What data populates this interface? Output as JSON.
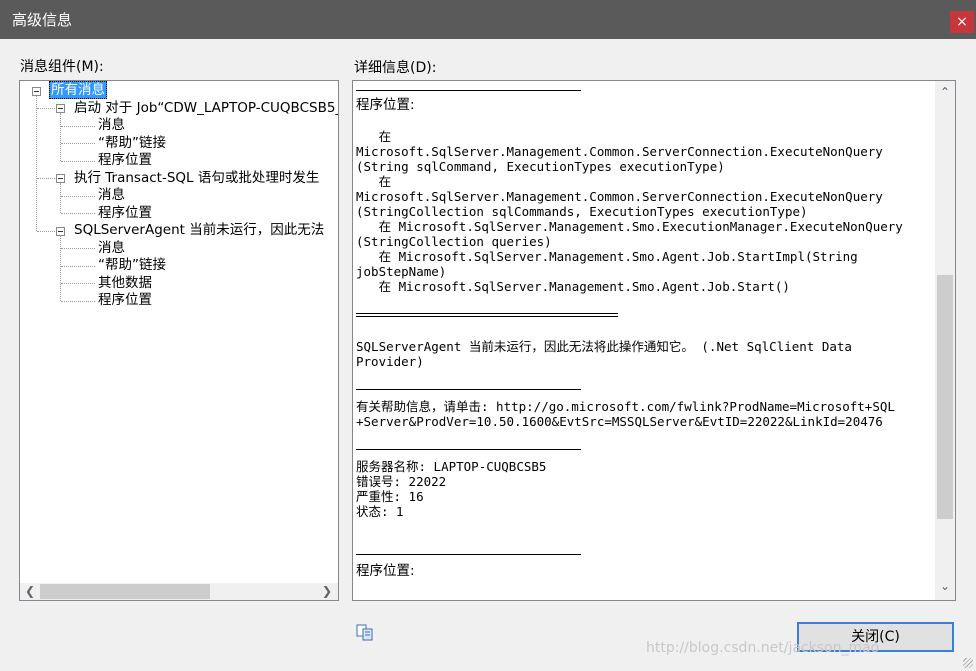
{
  "window": {
    "title": "高级信息",
    "close_glyph": "×"
  },
  "labels": {
    "message_components": "消息组件(M):",
    "details": "详细信息(D):"
  },
  "tree": {
    "root": "所有消息",
    "g1": "启动 对于 Job“CDW_LAPTOP-CUQBCSB5_",
    "g1_c1": "消息",
    "g1_c2": "“帮助”链接",
    "g1_c3": "程序位置",
    "g2": "执行 Transact-SQL 语句或批处理时发生",
    "g2_c1": "消息",
    "g2_c2": "程序位置",
    "g3": "SQLServerAgent 当前未运行，因此无法",
    "g3_c1": "消息",
    "g3_c2": "“帮助”链接",
    "g3_c3": "其他数据",
    "g3_c4": "程序位置"
  },
  "detail": {
    "loc1_heading": "程序位置:",
    "st1": "   在",
    "st2": "Microsoft.SqlServer.Management.Common.ServerConnection.ExecuteNonQuery",
    "st3": "(String sqlCommand, ExecutionTypes executionType)",
    "st4": "   在",
    "st5": "Microsoft.SqlServer.Management.Common.ServerConnection.ExecuteNonQuery",
    "st6": "(StringCollection sqlCommands, ExecutionTypes executionType)",
    "st7": "   在 Microsoft.SqlServer.Management.Smo.ExecutionManager.ExecuteNonQuery",
    "st8": "(StringCollection queries)",
    "st9": "   在 Microsoft.SqlServer.Management.Smo.Agent.Job.StartImpl(String",
    "st10": "jobStepName)",
    "st11": "   在 Microsoft.SqlServer.Management.Smo.Agent.Job.Start()",
    "msg1": "SQLServerAgent 当前未运行，因此无法将此操作通知它。 (.Net SqlClient Data",
    "msg2": "Provider)",
    "help1": "有关帮助信息，请单击: http://go.microsoft.com/fwlink?ProdName=Microsoft+SQL",
    "help2": "+Server&ProdVer=10.50.1600&EvtSrc=MSSQLServer&EvtID=22022&LinkId=20476",
    "server": "服务器名称: LAPTOP-CUQBCSB5",
    "errno": "错误号: 22022",
    "severity": "严重性: 16",
    "state": "状态: 1",
    "loc2_heading": "程序位置:"
  },
  "buttons": {
    "close": "关闭(C)"
  },
  "watermark": "http://blog.csdn.net/jackson_mao",
  "colors": {
    "titlebar": "#5a5a5a",
    "close_button": "#c7363a",
    "selection": "#3399ff"
  }
}
